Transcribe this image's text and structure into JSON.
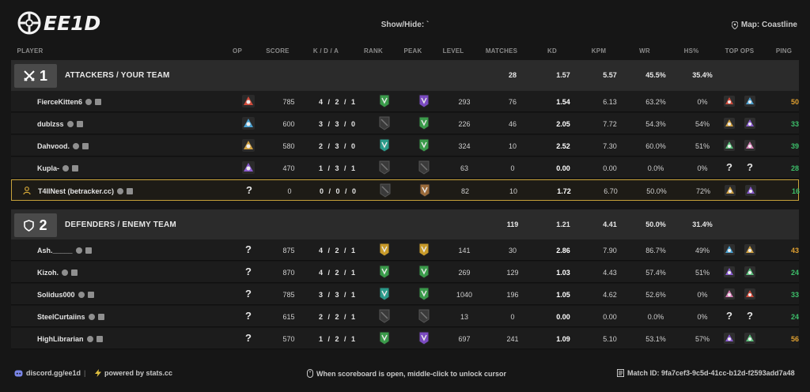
{
  "app": {
    "logo_text": "EE1D",
    "showhide": "Show/Hide: `",
    "map": "Map: Coastline"
  },
  "columns": {
    "player": "PLAYER",
    "op": "OP",
    "score": "SCORE",
    "kda": "K / D / A",
    "rank": "RANK",
    "peak": "PEAK",
    "level": "LEVEL",
    "matches": "MATCHES",
    "kd": "KD",
    "kpm": "KPM",
    "wr": "WR",
    "hs": "HS%",
    "top_ops": "TOP OPS",
    "ping": "PING"
  },
  "teams": [
    {
      "number": "1",
      "name": "ATTACKERS / YOUR TEAM",
      "summary": {
        "matches": "28",
        "kd": "1.57",
        "kpm": "5.57",
        "wr": "45.5%",
        "hs": "35.4%"
      },
      "players": [
        {
          "name": "FierceKitten6",
          "score": "785",
          "k": "4",
          "d": "2",
          "a": "1",
          "level": "293",
          "matches": "76",
          "kd": "1.54",
          "kpm": "6.13",
          "wr": "63.2%",
          "hs": "0%",
          "ping": "50",
          "ping_color": "#e0a030",
          "op_known": true,
          "rank": "green",
          "peak": "purple",
          "topops": [
            "op",
            "op"
          ]
        },
        {
          "name": "dublzss",
          "score": "600",
          "k": "3",
          "d": "3",
          "a": "0",
          "level": "226",
          "matches": "46",
          "kd": "2.05",
          "kpm": "7.72",
          "wr": "54.3%",
          "hs": "54%",
          "ping": "33",
          "ping_color": "#3cbf6a",
          "op_known": true,
          "rank": "none",
          "peak": "green",
          "topops": [
            "op",
            "op"
          ]
        },
        {
          "name": "Dahvood.",
          "score": "580",
          "k": "2",
          "d": "3",
          "a": "0",
          "level": "324",
          "matches": "10",
          "kd": "2.52",
          "kpm": "7.30",
          "wr": "60.0%",
          "hs": "51%",
          "ping": "39",
          "ping_color": "#3cbf6a",
          "op_known": true,
          "rank": "teal",
          "peak": "green",
          "topops": [
            "op",
            "op"
          ]
        },
        {
          "name": "Kupla-",
          "score": "470",
          "k": "1",
          "d": "3",
          "a": "1",
          "level": "63",
          "matches": "0",
          "kd": "0.00",
          "kpm": "0.00",
          "wr": "0.0%",
          "hs": "0%",
          "ping": "28",
          "ping_color": "#3cbf6a",
          "op_known": true,
          "rank": "none",
          "peak": "none",
          "topops": [
            "?",
            "?"
          ]
        },
        {
          "name": "T4llNest (betracker.cc)",
          "score": "0",
          "k": "0",
          "d": "0",
          "a": "0",
          "level": "82",
          "matches": "10",
          "kd": "1.72",
          "kpm": "6.70",
          "wr": "50.0%",
          "hs": "72%",
          "ping": "16",
          "ping_color": "#3cbf6a",
          "op_known": false,
          "rank": "none",
          "peak": "brown",
          "topops": [
            "op",
            "op"
          ],
          "highlight": true
        }
      ]
    },
    {
      "number": "2",
      "name": "DEFENDERS / ENEMY TEAM",
      "summary": {
        "matches": "119",
        "kd": "1.21",
        "kpm": "4.41",
        "wr": "50.0%",
        "hs": "31.4%"
      },
      "players": [
        {
          "name": "Ash._____",
          "score": "875",
          "k": "4",
          "d": "2",
          "a": "1",
          "level": "141",
          "matches": "30",
          "kd": "2.86",
          "kpm": "7.90",
          "wr": "86.7%",
          "hs": "49%",
          "ping": "43",
          "ping_color": "#e0a030",
          "op_known": false,
          "rank": "gold",
          "peak": "gold",
          "topops": [
            "op",
            "op"
          ]
        },
        {
          "name": "Kizoh.",
          "score": "870",
          "k": "4",
          "d": "2",
          "a": "1",
          "level": "269",
          "matches": "129",
          "kd": "1.03",
          "kpm": "4.43",
          "wr": "57.4%",
          "hs": "51%",
          "ping": "24",
          "ping_color": "#3cbf6a",
          "op_known": false,
          "rank": "green",
          "peak": "green",
          "topops": [
            "op",
            "op"
          ]
        },
        {
          "name": "Solidus000",
          "score": "785",
          "k": "3",
          "d": "3",
          "a": "1",
          "level": "1040",
          "matches": "196",
          "kd": "1.05",
          "kpm": "4.62",
          "wr": "52.6%",
          "hs": "0%",
          "ping": "33",
          "ping_color": "#3cbf6a",
          "op_known": false,
          "rank": "teal",
          "peak": "green",
          "topops": [
            "op",
            "op"
          ]
        },
        {
          "name": "SteelCurtaiins",
          "score": "615",
          "k": "2",
          "d": "2",
          "a": "1",
          "level": "13",
          "matches": "0",
          "kd": "0.00",
          "kpm": "0.00",
          "wr": "0.0%",
          "hs": "0%",
          "ping": "24",
          "ping_color": "#3cbf6a",
          "op_known": false,
          "rank": "none",
          "peak": "none",
          "topops": [
            "?",
            "?"
          ]
        },
        {
          "name": "HighLibrarian",
          "score": "570",
          "k": "1",
          "d": "2",
          "a": "1",
          "level": "697",
          "matches": "241",
          "kd": "1.09",
          "kpm": "5.10",
          "wr": "53.1%",
          "hs": "57%",
          "ping": "56",
          "ping_color": "#e0a030",
          "op_known": false,
          "rank": "green",
          "peak": "purple",
          "topops": [
            "op",
            "op"
          ]
        }
      ]
    }
  ],
  "footer": {
    "discord": "discord.gg/ee1d",
    "powered": "powered by stats.cc",
    "hint": "When scoreboard is open, middle-click to unlock cursor",
    "match_id": "Match ID: 9fa7cef3-9c5d-41cc-b12d-f2593add7a48"
  },
  "colors": {
    "background": "#161616",
    "highlight_border": "#c7a23a",
    "ping_good": "#3cbf6a",
    "ping_mid": "#e0a030"
  }
}
